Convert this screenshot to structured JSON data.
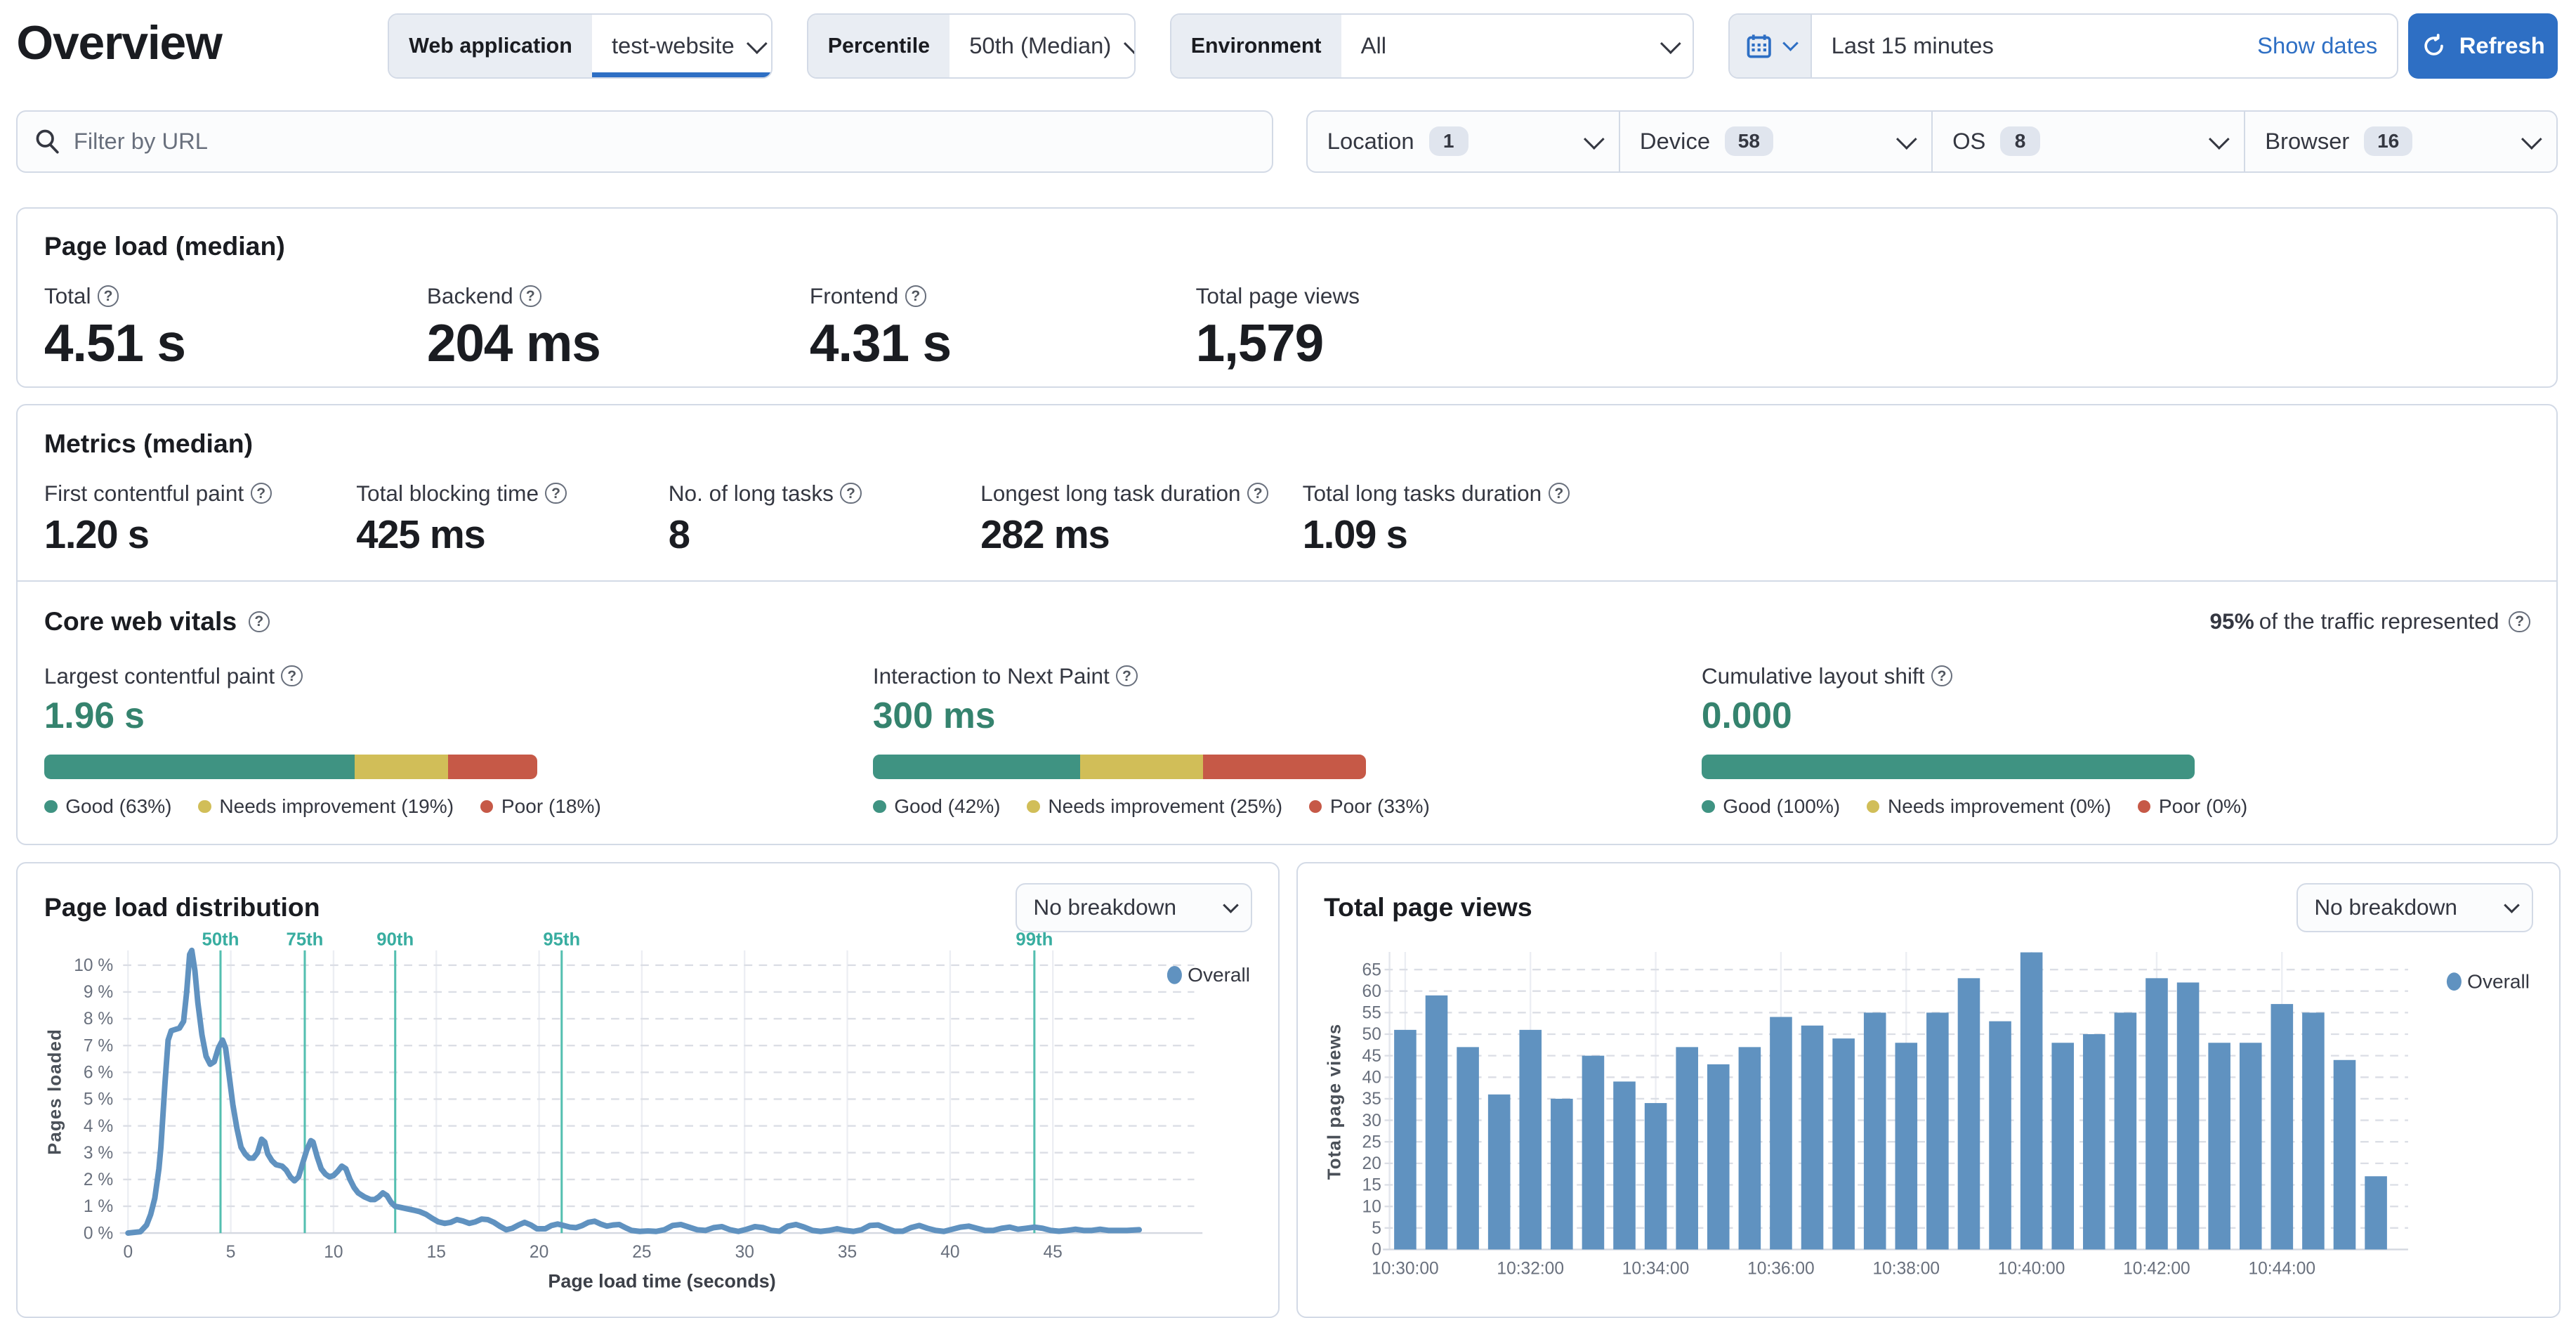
{
  "page": {
    "title": "Overview"
  },
  "colors": {
    "primary": "#2e6fc4",
    "series_blue": "#6092C0",
    "good": "#3F9382",
    "needs_improvement": "#D1BE58",
    "poor": "#C65947",
    "vital_value": "#35836E",
    "percentile_line": "#54BFB0",
    "percentile_label": "#38ADA0"
  },
  "icons": {
    "search": "magnifier",
    "calendar": "calendar-grid",
    "chevron": "chevron-down",
    "refresh": "circular-arrow",
    "help": "question-circle",
    "legend": "dot"
  },
  "toolbar": {
    "web_application": {
      "label": "Web application",
      "value": "test-website"
    },
    "percentile": {
      "label": "Percentile",
      "value": "50th (Median)"
    },
    "environment": {
      "label": "Environment",
      "value": "All"
    },
    "time_range": {
      "value": "Last 15 minutes",
      "show_dates_label": "Show dates"
    },
    "refresh_label": "Refresh"
  },
  "filters": {
    "url_placeholder": "Filter by URL",
    "dropdowns": [
      {
        "label": "Location",
        "count": "1"
      },
      {
        "label": "Device",
        "count": "58"
      },
      {
        "label": "OS",
        "count": "8"
      },
      {
        "label": "Browser",
        "count": "16"
      }
    ]
  },
  "page_load": {
    "title": "Page load (median)",
    "stats": [
      {
        "label": "Total",
        "value": "4.51 s"
      },
      {
        "label": "Backend",
        "value": "204 ms"
      },
      {
        "label": "Frontend",
        "value": "4.31 s"
      },
      {
        "label": "Total page views",
        "value": "1,579"
      }
    ]
  },
  "metrics": {
    "title": "Metrics (median)",
    "stats": [
      {
        "label": "First contentful paint",
        "value": "1.20 s"
      },
      {
        "label": "Total blocking time",
        "value": "425 ms"
      },
      {
        "label": "No. of long tasks",
        "value": "8"
      },
      {
        "label": "Longest long task duration",
        "value": "282 ms"
      },
      {
        "label": "Total long tasks duration",
        "value": "1.09 s"
      }
    ]
  },
  "core_web_vitals": {
    "title": "Core web vitals",
    "traffic_strong": "95%",
    "traffic_rest": " of the traffic represented",
    "vitals": [
      {
        "label": "Largest contentful paint",
        "value": "1.96 s",
        "good": 63,
        "needs": 19,
        "poor": 18,
        "legend": [
          "Good (63%)",
          "Needs improvement (19%)",
          "Poor (18%)"
        ]
      },
      {
        "label": "Interaction to Next Paint",
        "value": "300 ms",
        "good": 42,
        "needs": 25,
        "poor": 33,
        "legend": [
          "Good (42%)",
          "Needs improvement (25%)",
          "Poor (33%)"
        ]
      },
      {
        "label": "Cumulative layout shift",
        "value": "0.000",
        "good": 100,
        "needs": 0,
        "poor": 0,
        "legend": [
          "Good (100%)",
          "Needs improvement (0%)",
          "Poor (0%)"
        ]
      }
    ]
  },
  "chart_data": [
    {
      "type": "line",
      "title": "Page load distribution",
      "breakdown_selector": "No breakdown",
      "xlabel": "Page load time (seconds)",
      "ylabel": "Pages loaded",
      "x_ticks": [
        0,
        5,
        10,
        15,
        20,
        25,
        30,
        35,
        40,
        45
      ],
      "y_ticks_percent": [
        0,
        1,
        2,
        3,
        4,
        5,
        6,
        7,
        8,
        9,
        10
      ],
      "xlim": [
        0,
        49.5
      ],
      "ylim": [
        0,
        10.8
      ],
      "legend": [
        "Overall"
      ],
      "grid": true,
      "legend_position": "top-right",
      "percentile_markers": [
        {
          "label": "50th",
          "x": 4.5
        },
        {
          "label": "75th",
          "x": 8.6
        },
        {
          "label": "90th",
          "x": 13.0
        },
        {
          "label": "95th",
          "x": 21.1
        },
        {
          "label": "99th",
          "x": 44.1
        }
      ],
      "points": [
        [
          0,
          0
        ],
        [
          0.6,
          0.05
        ],
        [
          0.9,
          0.3
        ],
        [
          1.1,
          0.7
        ],
        [
          1.3,
          1.3
        ],
        [
          1.5,
          2.4
        ],
        [
          1.6,
          3.2
        ],
        [
          1.8,
          5.6
        ],
        [
          1.95,
          7.2
        ],
        [
          2.1,
          7.55
        ],
        [
          2.3,
          7.6
        ],
        [
          2.5,
          7.65
        ],
        [
          2.7,
          7.9
        ],
        [
          2.85,
          9.0
        ],
        [
          3.0,
          10.4
        ],
        [
          3.1,
          10.55
        ],
        [
          3.25,
          9.8
        ],
        [
          3.4,
          8.6
        ],
        [
          3.6,
          7.4
        ],
        [
          3.8,
          6.6
        ],
        [
          4.0,
          6.3
        ],
        [
          4.2,
          6.4
        ],
        [
          4.4,
          6.9
        ],
        [
          4.6,
          7.2
        ],
        [
          4.75,
          6.9
        ],
        [
          4.9,
          6.0
        ],
        [
          5.1,
          4.8
        ],
        [
          5.3,
          3.9
        ],
        [
          5.5,
          3.2
        ],
        [
          5.7,
          2.95
        ],
        [
          5.9,
          2.8
        ],
        [
          6.1,
          2.8
        ],
        [
          6.3,
          3.0
        ],
        [
          6.5,
          3.5
        ],
        [
          6.65,
          3.4
        ],
        [
          6.8,
          2.95
        ],
        [
          7.0,
          2.7
        ],
        [
          7.2,
          2.55
        ],
        [
          7.5,
          2.5
        ],
        [
          7.7,
          2.35
        ],
        [
          7.9,
          2.1
        ],
        [
          8.1,
          1.95
        ],
        [
          8.3,
          2.1
        ],
        [
          8.5,
          2.6
        ],
        [
          8.7,
          3.1
        ],
        [
          8.9,
          3.45
        ],
        [
          9.0,
          3.4
        ],
        [
          9.2,
          2.85
        ],
        [
          9.4,
          2.4
        ],
        [
          9.6,
          2.2
        ],
        [
          9.8,
          2.1
        ],
        [
          10.0,
          2.15
        ],
        [
          10.2,
          2.3
        ],
        [
          10.4,
          2.5
        ],
        [
          10.6,
          2.4
        ],
        [
          10.8,
          2.0
        ],
        [
          11.0,
          1.7
        ],
        [
          11.2,
          1.5
        ],
        [
          11.5,
          1.35
        ],
        [
          11.8,
          1.25
        ],
        [
          12.0,
          1.25
        ],
        [
          12.2,
          1.35
        ],
        [
          12.4,
          1.5
        ],
        [
          12.6,
          1.4
        ],
        [
          12.8,
          1.15
        ],
        [
          13.0,
          1.0
        ],
        [
          13.3,
          0.95
        ],
        [
          13.6,
          0.9
        ],
        [
          13.9,
          0.85
        ],
        [
          14.2,
          0.8
        ],
        [
          14.5,
          0.7
        ],
        [
          14.8,
          0.55
        ],
        [
          15.1,
          0.42
        ],
        [
          15.4,
          0.36
        ],
        [
          15.7,
          0.4
        ],
        [
          16.0,
          0.5
        ],
        [
          16.3,
          0.45
        ],
        [
          16.6,
          0.36
        ],
        [
          16.9,
          0.42
        ],
        [
          17.2,
          0.52
        ],
        [
          17.5,
          0.5
        ],
        [
          17.8,
          0.4
        ],
        [
          18.1,
          0.25
        ],
        [
          18.4,
          0.12
        ],
        [
          18.7,
          0.18
        ],
        [
          19.0,
          0.3
        ],
        [
          19.3,
          0.4
        ],
        [
          19.6,
          0.3
        ],
        [
          19.9,
          0.16
        ],
        [
          20.3,
          0.16
        ],
        [
          20.6,
          0.28
        ],
        [
          20.9,
          0.34
        ],
        [
          21.2,
          0.28
        ],
        [
          21.5,
          0.22
        ],
        [
          21.8,
          0.2
        ],
        [
          22.1,
          0.28
        ],
        [
          22.4,
          0.4
        ],
        [
          22.7,
          0.44
        ],
        [
          23.0,
          0.34
        ],
        [
          23.3,
          0.26
        ],
        [
          23.6,
          0.3
        ],
        [
          23.9,
          0.32
        ],
        [
          24.2,
          0.2
        ],
        [
          24.5,
          0.1
        ],
        [
          24.9,
          0.06
        ],
        [
          25.3,
          0.08
        ],
        [
          25.7,
          0.06
        ],
        [
          26.1,
          0.12
        ],
        [
          26.5,
          0.28
        ],
        [
          26.9,
          0.32
        ],
        [
          27.3,
          0.22
        ],
        [
          27.7,
          0.12
        ],
        [
          28.1,
          0.1
        ],
        [
          28.5,
          0.2
        ],
        [
          28.9,
          0.24
        ],
        [
          29.3,
          0.12
        ],
        [
          29.7,
          0.06
        ],
        [
          30.1,
          0.14
        ],
        [
          30.5,
          0.24
        ],
        [
          30.9,
          0.2
        ],
        [
          31.3,
          0.1
        ],
        [
          31.7,
          0.07
        ],
        [
          32.1,
          0.26
        ],
        [
          32.5,
          0.32
        ],
        [
          32.9,
          0.22
        ],
        [
          33.3,
          0.1
        ],
        [
          33.7,
          0.06
        ],
        [
          34.1,
          0.1
        ],
        [
          34.5,
          0.16
        ],
        [
          34.9,
          0.1
        ],
        [
          35.3,
          0.06
        ],
        [
          35.7,
          0.12
        ],
        [
          36.1,
          0.28
        ],
        [
          36.5,
          0.3
        ],
        [
          36.9,
          0.18
        ],
        [
          37.3,
          0.07
        ],
        [
          37.7,
          0.07
        ],
        [
          38.1,
          0.2
        ],
        [
          38.5,
          0.28
        ],
        [
          38.9,
          0.18
        ],
        [
          39.3,
          0.1
        ],
        [
          39.7,
          0.06
        ],
        [
          40.1,
          0.14
        ],
        [
          40.5,
          0.22
        ],
        [
          40.9,
          0.26
        ],
        [
          41.3,
          0.18
        ],
        [
          41.7,
          0.1
        ],
        [
          42.1,
          0.1
        ],
        [
          42.5,
          0.18
        ],
        [
          42.9,
          0.22
        ],
        [
          43.3,
          0.14
        ],
        [
          43.7,
          0.18
        ],
        [
          44.1,
          0.22
        ],
        [
          44.5,
          0.18
        ],
        [
          44.9,
          0.1
        ],
        [
          45.3,
          0.07
        ],
        [
          45.7,
          0.1
        ],
        [
          46.1,
          0.14
        ],
        [
          46.5,
          0.1
        ],
        [
          46.9,
          0.1
        ],
        [
          47.3,
          0.14
        ],
        [
          47.7,
          0.1
        ],
        [
          48.1,
          0.1
        ],
        [
          48.6,
          0.1
        ],
        [
          49.2,
          0.12
        ]
      ]
    },
    {
      "type": "bar",
      "title": "Total page views",
      "breakdown_selector": "No breakdown",
      "ylabel": "Total page views",
      "y_ticks": [
        0,
        5,
        10,
        15,
        20,
        25,
        30,
        35,
        40,
        45,
        50,
        55,
        60,
        65
      ],
      "ylim": [
        0,
        70
      ],
      "legend": [
        "Overall"
      ],
      "grid": true,
      "legend_position": "top-right",
      "label_every": 4,
      "x_labels": [
        "10:30:00",
        "10:32:00",
        "10:34:00",
        "10:36:00",
        "10:38:00",
        "10:40:00",
        "10:42:00",
        "10:44:00"
      ],
      "values": [
        51,
        59,
        47,
        36,
        51,
        35,
        45,
        39,
        34,
        47,
        43,
        47,
        54,
        52,
        49,
        55,
        48,
        55,
        63,
        53,
        69,
        48,
        50,
        55,
        63,
        62,
        48,
        48,
        57,
        55,
        44,
        17
      ]
    }
  ]
}
